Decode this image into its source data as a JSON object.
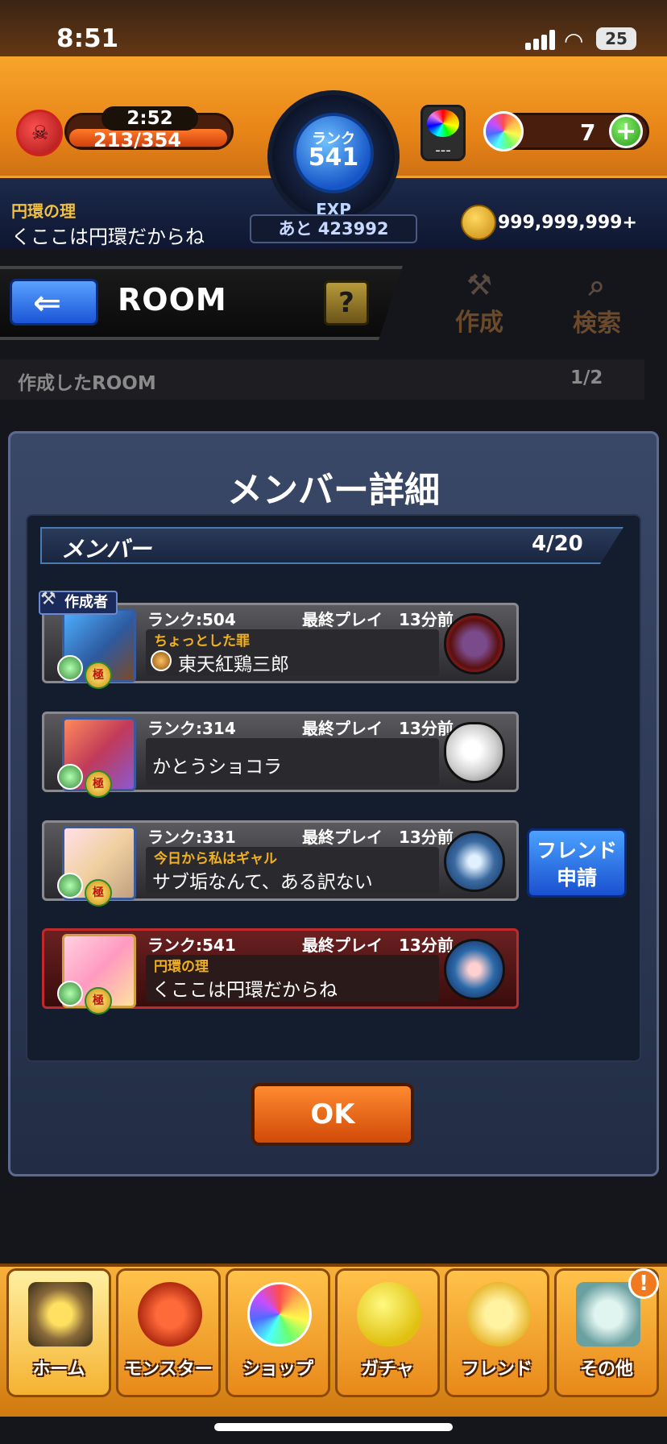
{
  "status_bar": {
    "time": "8:51",
    "battery": "25"
  },
  "header": {
    "stamina_timer": "2:52",
    "stamina": "213/354",
    "rank_label": "ランク",
    "rank": "541",
    "exp_label": "EXP",
    "exp_remaining": "あと 423992",
    "orb_cap_text": "---",
    "orbs": "7",
    "title": "円環の理",
    "nickname": "くここは円環だからね",
    "coins": "999,999,999+"
  },
  "room_bar": {
    "title": "ROOM",
    "help": "?",
    "create_label": "作成",
    "search_label": "検索",
    "created_label": "作成したROOM",
    "created_count": "1/2"
  },
  "modal": {
    "title": "メンバー詳細",
    "members_label": "メンバー",
    "members_count": "4/20",
    "creator_tag": "作成者",
    "members": [
      {
        "rank": "ランク:504",
        "last_play": "最終プレイ　13分前",
        "title": "ちょっとした罪",
        "name": "東天紅鶏三郎"
      },
      {
        "rank": "ランク:314",
        "last_play": "最終プレイ　13分前",
        "title": "",
        "name": "かとうショコラ"
      },
      {
        "rank": "ランク:331",
        "last_play": "最終プレイ　13分前",
        "title": "今日から私はギャル",
        "name": "サブ垢なんて、ある訳ない"
      },
      {
        "rank": "ランク:541",
        "last_play": "最終プレイ　13分前",
        "title": "円環の理",
        "name": "くここは円環だからね"
      }
    ],
    "friend_request_line1": "フレンド",
    "friend_request_line2": "申請",
    "ok": "OK",
    "badge_text": "極"
  },
  "nav": {
    "items": [
      {
        "label": "ホーム"
      },
      {
        "label": "モンスター"
      },
      {
        "label": "ショップ"
      },
      {
        "label": "ガチャ"
      },
      {
        "label": "フレンド"
      },
      {
        "label": "その他"
      }
    ],
    "alert": "!"
  }
}
